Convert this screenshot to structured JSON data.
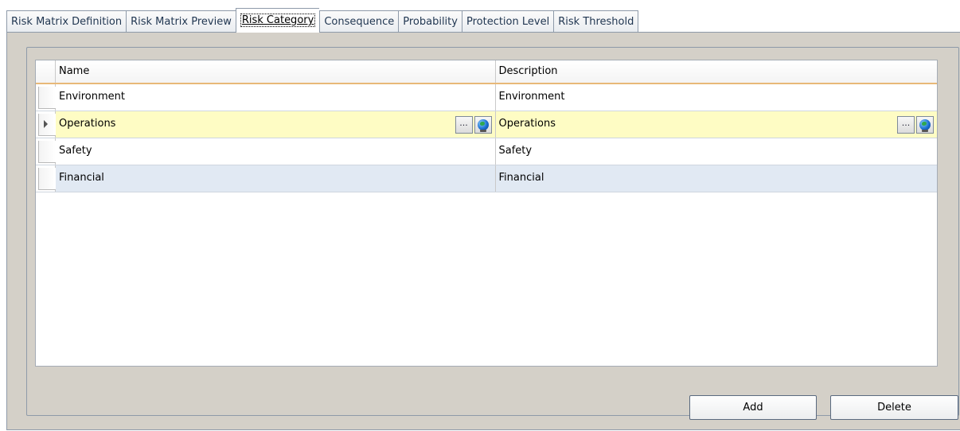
{
  "tabs": [
    {
      "label": "Risk Matrix Definition"
    },
    {
      "label": "Risk Matrix Preview"
    },
    {
      "label": "Risk Category",
      "active": true
    },
    {
      "label": "Consequence"
    },
    {
      "label": "Probability"
    },
    {
      "label": "Protection Level"
    },
    {
      "label": "Risk Threshold"
    }
  ],
  "grid": {
    "columns": [
      "Name",
      "Description"
    ],
    "rows": [
      {
        "name": "Environment",
        "description": "Environment"
      },
      {
        "name": "Operations",
        "description": "Operations",
        "current": true
      },
      {
        "name": "Safety",
        "description": "Safety"
      },
      {
        "name": "Financial",
        "description": "Financial"
      }
    ],
    "ellipsis_label": "···"
  },
  "buttons": {
    "add": "Add",
    "delete": "Delete"
  },
  "icons": {
    "row_indicator": "row-pointer-icon",
    "browse": "ellipsis-icon",
    "localize": "globe-icon"
  },
  "colors": {
    "current_row": "#fefcc4",
    "alt_row": "#e1e9f3",
    "header_underline": "#e8b878",
    "panel": "#d4d0c8"
  }
}
